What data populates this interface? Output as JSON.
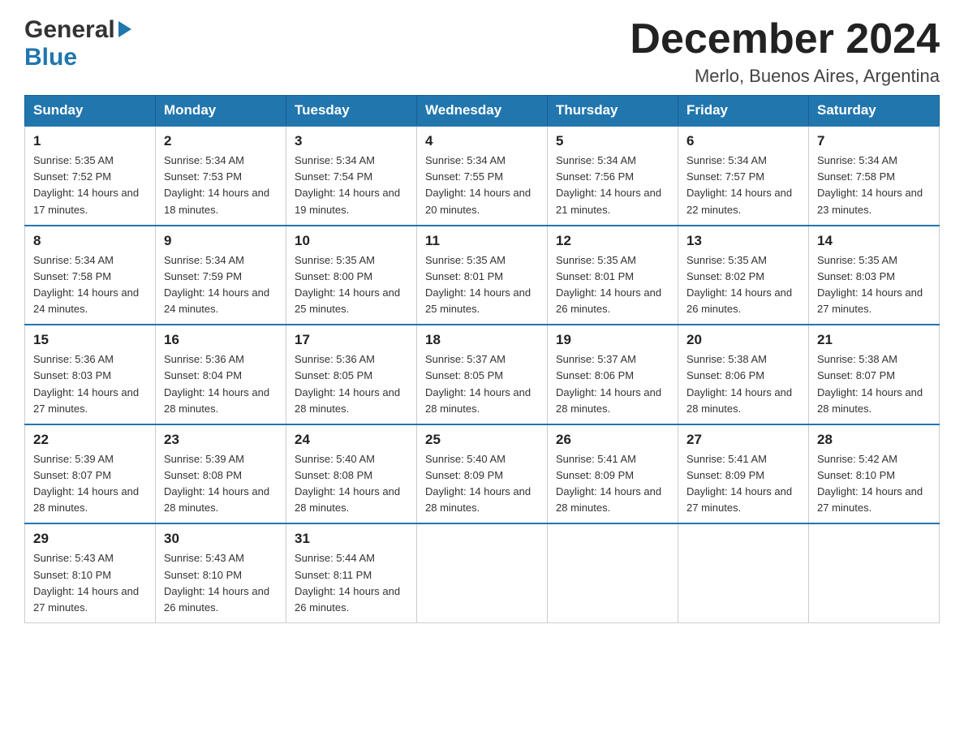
{
  "header": {
    "logo_general": "General",
    "logo_blue": "Blue",
    "month_title": "December 2024",
    "location": "Merlo, Buenos Aires, Argentina"
  },
  "calendar": {
    "days_of_week": [
      "Sunday",
      "Monday",
      "Tuesday",
      "Wednesday",
      "Thursday",
      "Friday",
      "Saturday"
    ],
    "weeks": [
      [
        {
          "day": "1",
          "sunrise": "5:35 AM",
          "sunset": "7:52 PM",
          "daylight": "14 hours and 17 minutes."
        },
        {
          "day": "2",
          "sunrise": "5:34 AM",
          "sunset": "7:53 PM",
          "daylight": "14 hours and 18 minutes."
        },
        {
          "day": "3",
          "sunrise": "5:34 AM",
          "sunset": "7:54 PM",
          "daylight": "14 hours and 19 minutes."
        },
        {
          "day": "4",
          "sunrise": "5:34 AM",
          "sunset": "7:55 PM",
          "daylight": "14 hours and 20 minutes."
        },
        {
          "day": "5",
          "sunrise": "5:34 AM",
          "sunset": "7:56 PM",
          "daylight": "14 hours and 21 minutes."
        },
        {
          "day": "6",
          "sunrise": "5:34 AM",
          "sunset": "7:57 PM",
          "daylight": "14 hours and 22 minutes."
        },
        {
          "day": "7",
          "sunrise": "5:34 AM",
          "sunset": "7:58 PM",
          "daylight": "14 hours and 23 minutes."
        }
      ],
      [
        {
          "day": "8",
          "sunrise": "5:34 AM",
          "sunset": "7:58 PM",
          "daylight": "14 hours and 24 minutes."
        },
        {
          "day": "9",
          "sunrise": "5:34 AM",
          "sunset": "7:59 PM",
          "daylight": "14 hours and 24 minutes."
        },
        {
          "day": "10",
          "sunrise": "5:35 AM",
          "sunset": "8:00 PM",
          "daylight": "14 hours and 25 minutes."
        },
        {
          "day": "11",
          "sunrise": "5:35 AM",
          "sunset": "8:01 PM",
          "daylight": "14 hours and 25 minutes."
        },
        {
          "day": "12",
          "sunrise": "5:35 AM",
          "sunset": "8:01 PM",
          "daylight": "14 hours and 26 minutes."
        },
        {
          "day": "13",
          "sunrise": "5:35 AM",
          "sunset": "8:02 PM",
          "daylight": "14 hours and 26 minutes."
        },
        {
          "day": "14",
          "sunrise": "5:35 AM",
          "sunset": "8:03 PM",
          "daylight": "14 hours and 27 minutes."
        }
      ],
      [
        {
          "day": "15",
          "sunrise": "5:36 AM",
          "sunset": "8:03 PM",
          "daylight": "14 hours and 27 minutes."
        },
        {
          "day": "16",
          "sunrise": "5:36 AM",
          "sunset": "8:04 PM",
          "daylight": "14 hours and 28 minutes."
        },
        {
          "day": "17",
          "sunrise": "5:36 AM",
          "sunset": "8:05 PM",
          "daylight": "14 hours and 28 minutes."
        },
        {
          "day": "18",
          "sunrise": "5:37 AM",
          "sunset": "8:05 PM",
          "daylight": "14 hours and 28 minutes."
        },
        {
          "day": "19",
          "sunrise": "5:37 AM",
          "sunset": "8:06 PM",
          "daylight": "14 hours and 28 minutes."
        },
        {
          "day": "20",
          "sunrise": "5:38 AM",
          "sunset": "8:06 PM",
          "daylight": "14 hours and 28 minutes."
        },
        {
          "day": "21",
          "sunrise": "5:38 AM",
          "sunset": "8:07 PM",
          "daylight": "14 hours and 28 minutes."
        }
      ],
      [
        {
          "day": "22",
          "sunrise": "5:39 AM",
          "sunset": "8:07 PM",
          "daylight": "14 hours and 28 minutes."
        },
        {
          "day": "23",
          "sunrise": "5:39 AM",
          "sunset": "8:08 PM",
          "daylight": "14 hours and 28 minutes."
        },
        {
          "day": "24",
          "sunrise": "5:40 AM",
          "sunset": "8:08 PM",
          "daylight": "14 hours and 28 minutes."
        },
        {
          "day": "25",
          "sunrise": "5:40 AM",
          "sunset": "8:09 PM",
          "daylight": "14 hours and 28 minutes."
        },
        {
          "day": "26",
          "sunrise": "5:41 AM",
          "sunset": "8:09 PM",
          "daylight": "14 hours and 28 minutes."
        },
        {
          "day": "27",
          "sunrise": "5:41 AM",
          "sunset": "8:09 PM",
          "daylight": "14 hours and 27 minutes."
        },
        {
          "day": "28",
          "sunrise": "5:42 AM",
          "sunset": "8:10 PM",
          "daylight": "14 hours and 27 minutes."
        }
      ],
      [
        {
          "day": "29",
          "sunrise": "5:43 AM",
          "sunset": "8:10 PM",
          "daylight": "14 hours and 27 minutes."
        },
        {
          "day": "30",
          "sunrise": "5:43 AM",
          "sunset": "8:10 PM",
          "daylight": "14 hours and 26 minutes."
        },
        {
          "day": "31",
          "sunrise": "5:44 AM",
          "sunset": "8:11 PM",
          "daylight": "14 hours and 26 minutes."
        },
        null,
        null,
        null,
        null
      ]
    ]
  }
}
